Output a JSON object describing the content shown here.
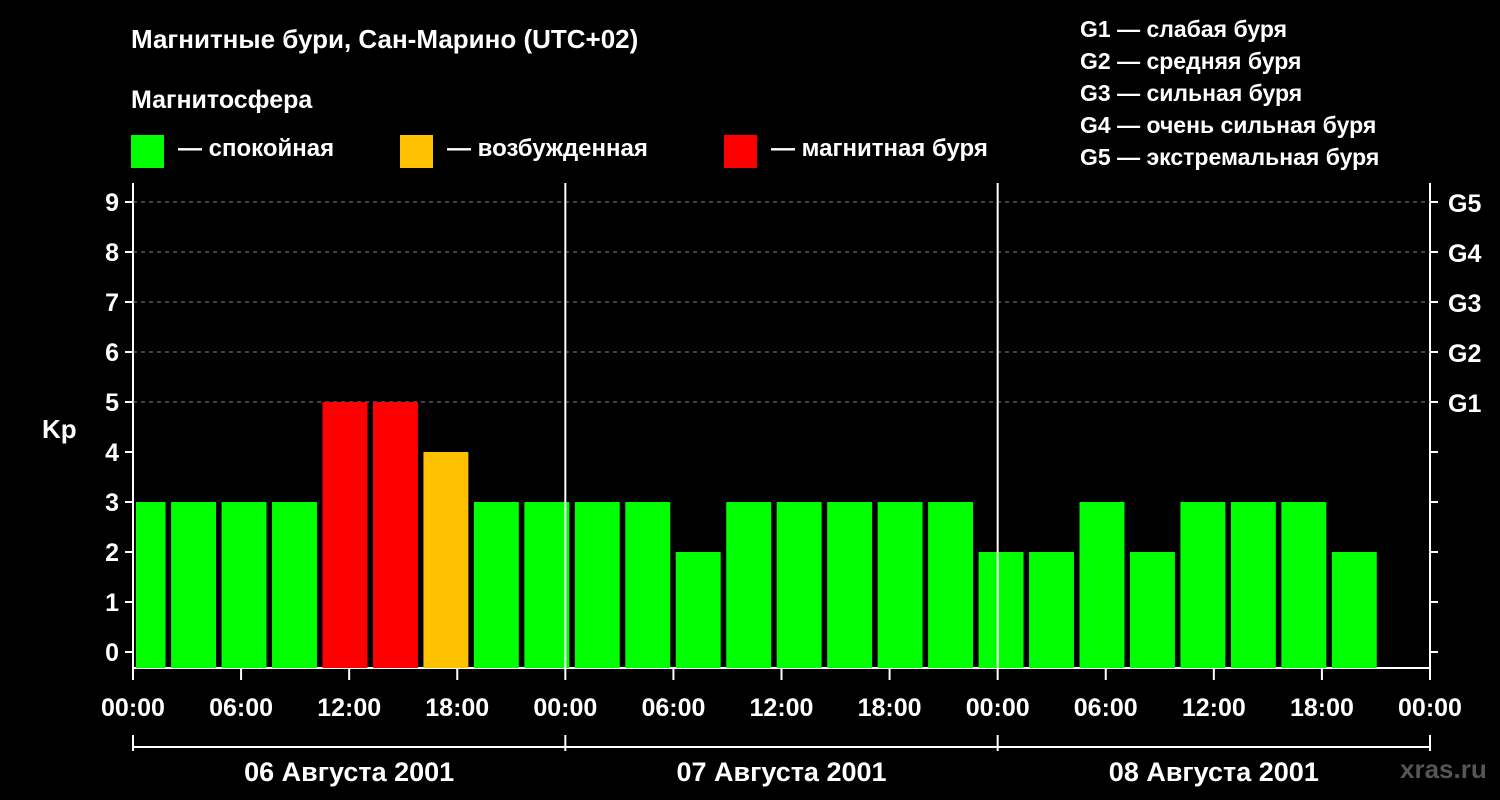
{
  "header": {
    "title": "Магнитные бури, Сан-Марино (UTC+02)",
    "subtitle": "Магнитосфера"
  },
  "legend": [
    {
      "color": "#00ff00",
      "label": "— спокойная"
    },
    {
      "color": "#ffc000",
      "label": "— возбужденная"
    },
    {
      "color": "#ff0000",
      "label": "— магнитная буря"
    }
  ],
  "storm_levels": [
    "G1 — слабая буря",
    "G2 — средняя буря",
    "G3 — сильная буря",
    "G4 — очень сильная буря",
    "G5 — экстремальная буря"
  ],
  "watermark": "xras.ru",
  "chart_data": {
    "type": "bar",
    "ylabel": "Kp",
    "ylim": [
      0,
      9
    ],
    "yticks": [
      "0",
      "1",
      "2",
      "3",
      "4",
      "5",
      "6",
      "7",
      "8",
      "9"
    ],
    "right_ticks": [
      {
        "value": 5,
        "label": "G1"
      },
      {
        "value": 6,
        "label": "G2"
      },
      {
        "value": 7,
        "label": "G3"
      },
      {
        "value": 8,
        "label": "G4"
      },
      {
        "value": 9,
        "label": "G5"
      }
    ],
    "xticks": [
      "00:00",
      "06:00",
      "12:00",
      "18:00",
      "00:00",
      "06:00",
      "12:00",
      "18:00",
      "00:00",
      "06:00",
      "12:00",
      "18:00",
      "00:00"
    ],
    "days": [
      "06 Августа 2001",
      "07 Августа 2001",
      "08 Августа 2001"
    ],
    "hours_per_bar": 3,
    "values": [
      3,
      3,
      3,
      3,
      5,
      5,
      4,
      3,
      3,
      3,
      3,
      2,
      3,
      3,
      3,
      3,
      3,
      2,
      2,
      3,
      2,
      3,
      3,
      3,
      2
    ],
    "colors": {
      "calm": "#00ff00",
      "excited": "#ffc000",
      "storm": "#ff0000"
    },
    "grid": true
  }
}
